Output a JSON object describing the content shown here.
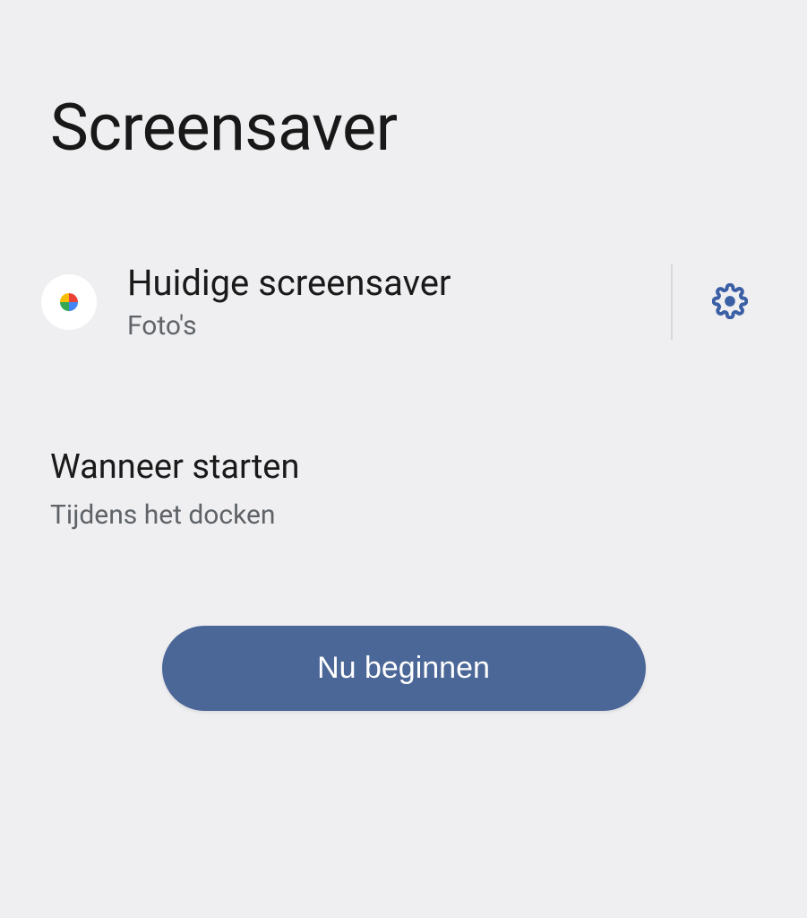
{
  "title": "Screensaver",
  "current": {
    "label": "Huidige screensaver",
    "value": "Foto's",
    "icon_name": "google-photos-icon",
    "settings_icon_name": "gear-icon"
  },
  "when": {
    "label": "Wanneer starten",
    "value": "Tijdens het docken"
  },
  "actions": {
    "start_now": "Nu beginnen"
  },
  "colors": {
    "accent": "#4b6798",
    "bg": "#efeff1",
    "text_secondary": "#5f6368",
    "gear": "#3b5fa5"
  }
}
